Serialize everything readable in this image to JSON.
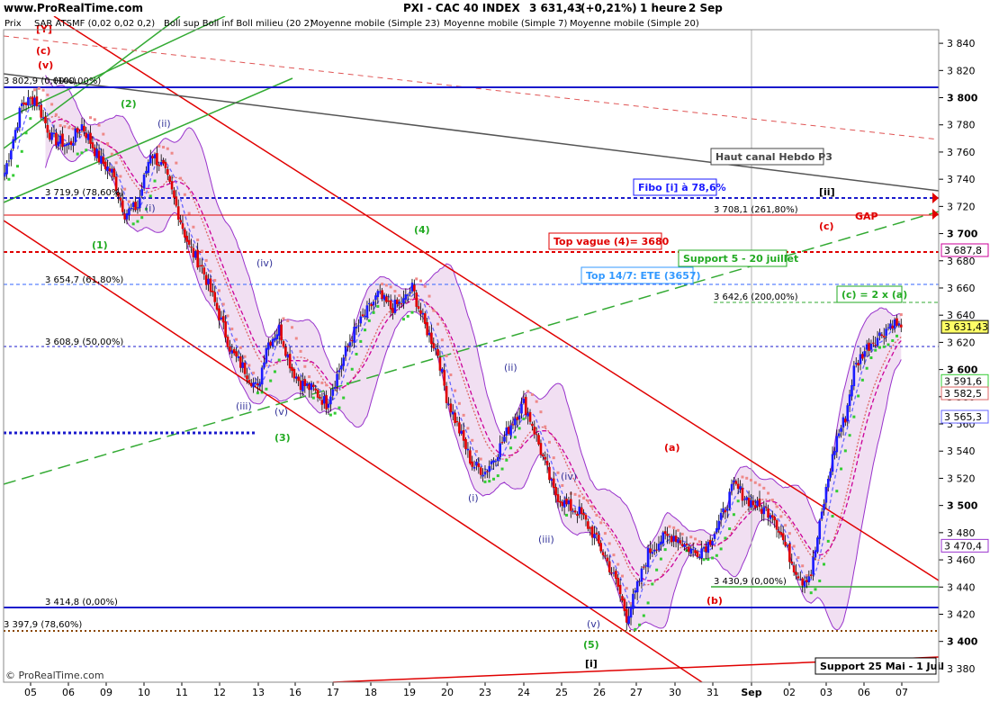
{
  "header": {
    "site": "www.ProRealTime.com",
    "symbol": "PXI - CAC 40 INDEX",
    "price": "3 631,43",
    "change": "(+0,21%)",
    "timeframe": "1 heure",
    "date": "2 Sep"
  },
  "legend": {
    "price_label": "Prix",
    "items": [
      {
        "label": "SAR ATSMF (0,02 0,02 0,2)",
        "color": "#33cc33"
      },
      {
        "label": "Boll sup Boll inf Boll milieu (20 2)",
        "color": "#800080"
      },
      {
        "label": "Moyenne mobile (Simple 23)",
        "color": "#cc0099"
      },
      {
        "label": "Moyenne mobile (Simple 7)",
        "color": "#6666ff"
      },
      {
        "label": "Moyenne mobile (Simple 20)",
        "color": "#dd6666"
      }
    ]
  },
  "copyright": "© ProRealTime.com",
  "colors": {
    "bull": "#1a1aff",
    "bear": "#e00000",
    "boll_fill": "#efd9f0",
    "boll_line": "#9933cc",
    "sar": "#33cc33",
    "sma7": "#6666ff",
    "sma20": "#dd6666",
    "sma23": "#cc0099",
    "channel": "#e00000",
    "green_line": "#33aa33",
    "grey_line": "#555555"
  },
  "chart_data": {
    "type": "candlestick",
    "instrument": "PXI - CAC 40 INDEX",
    "timeframe": "1 heure",
    "ylim": [
      3370,
      3850
    ],
    "y_ticks": [
      3380,
      3400,
      3420,
      3440,
      3460,
      3480,
      3500,
      3520,
      3540,
      3560,
      3580,
      3600,
      3620,
      3640,
      3660,
      3680,
      3700,
      3720,
      3740,
      3760,
      3780,
      3800,
      3820,
      3840
    ],
    "y_tick_labels": [
      "3 380",
      "3 400",
      "3 420",
      "3 440",
      "3 460",
      "3 480",
      "3 500",
      "3 520",
      "3 540",
      "3 560",
      "3 580",
      "3 600",
      "3 620",
      "3 640",
      "3 660",
      "3 680",
      "3 700",
      "3 720",
      "3 740",
      "3 760",
      "3 780",
      "3 800",
      "3 820",
      "3 840"
    ],
    "x_labels": [
      "05",
      "06",
      "09",
      "10",
      "11",
      "12",
      "13",
      "16",
      "17",
      "18",
      "19",
      "20",
      "23",
      "24",
      "25",
      "26",
      "27",
      "30",
      "31",
      "Sep",
      "02",
      "03",
      "06",
      "07"
    ],
    "waypoints": [
      [
        0,
        3745
      ],
      [
        8,
        3795
      ],
      [
        14,
        3800
      ],
      [
        22,
        3770
      ],
      [
        30,
        3765
      ],
      [
        36,
        3780
      ],
      [
        44,
        3755
      ],
      [
        50,
        3745
      ],
      [
        56,
        3715
      ],
      [
        62,
        3720
      ],
      [
        68,
        3760
      ],
      [
        74,
        3748
      ],
      [
        78,
        3730
      ],
      [
        86,
        3690
      ],
      [
        92,
        3675
      ],
      [
        100,
        3640
      ],
      [
        106,
        3612
      ],
      [
        112,
        3600
      ],
      [
        118,
        3585
      ],
      [
        122,
        3618
      ],
      [
        128,
        3630
      ],
      [
        134,
        3600
      ],
      [
        138,
        3590
      ],
      [
        144,
        3585
      ],
      [
        150,
        3575
      ],
      [
        156,
        3600
      ],
      [
        162,
        3625
      ],
      [
        168,
        3640
      ],
      [
        174,
        3655
      ],
      [
        180,
        3645
      ],
      [
        186,
        3650
      ],
      [
        190,
        3660
      ],
      [
        196,
        3632
      ],
      [
        202,
        3612
      ],
      [
        206,
        3580
      ],
      [
        212,
        3555
      ],
      [
        218,
        3530
      ],
      [
        224,
        3525
      ],
      [
        230,
        3540
      ],
      [
        236,
        3560
      ],
      [
        242,
        3575
      ],
      [
        246,
        3560
      ],
      [
        250,
        3540
      ],
      [
        256,
        3510
      ],
      [
        262,
        3500
      ],
      [
        268,
        3495
      ],
      [
        274,
        3480
      ],
      [
        280,
        3462
      ],
      [
        286,
        3440
      ],
      [
        290,
        3418
      ],
      [
        294,
        3435
      ],
      [
        300,
        3465
      ],
      [
        306,
        3475
      ],
      [
        312,
        3478
      ],
      [
        318,
        3470
      ],
      [
        322,
        3465
      ],
      [
        328,
        3472
      ],
      [
        334,
        3490
      ],
      [
        340,
        3515
      ],
      [
        346,
        3505
      ],
      [
        352,
        3498
      ],
      [
        358,
        3495
      ],
      [
        364,
        3470
      ],
      [
        368,
        3455
      ],
      [
        372,
        3445
      ],
      [
        376,
        3450
      ],
      [
        380,
        3485
      ],
      [
        384,
        3520
      ],
      [
        388,
        3550
      ],
      [
        392,
        3565
      ],
      [
        396,
        3600
      ],
      [
        400,
        3612
      ],
      [
        404,
        3620
      ],
      [
        408,
        3625
      ],
      [
        414,
        3635
      ],
      [
        418,
        3631
      ]
    ],
    "annotation_levels": [
      {
        "label": "3 802,9 (0,00%)",
        "value": 3802.9
      },
      {
        "label": "(100,00%)",
        "value": 3802.9
      },
      {
        "label": "3 719,9 (78,60%)",
        "value": 3719.9
      },
      {
        "label": "3 708,1 (261,80%)",
        "value": 3708.1
      },
      {
        "label": "3 654,7 (61,80%)",
        "value": 3654.7
      },
      {
        "label": "3 642,6 (200,00%)",
        "value": 3642.6
      },
      {
        "label": "3 608,9 (50,00%)",
        "value": 3608.9
      },
      {
        "label": "3 430,9 (0,00%)",
        "value": 3430.9
      },
      {
        "label": "3 414,8 (0,00%)",
        "value": 3414.8
      },
      {
        "label": "3 397,9 (78,60%)",
        "value": 3397.9
      }
    ],
    "price_badges": [
      {
        "label": "3 687,8",
        "value": 3687.8,
        "color": "#cc0099"
      },
      {
        "label": "3 631,43",
        "value": 3631.43,
        "color": "#000000",
        "fill": "#ffff66"
      },
      {
        "label": "3 591,6",
        "value": 3591.6,
        "color": "#33cc33"
      },
      {
        "label": "3 582,5",
        "value": 3582.5,
        "color": "#dd6666"
      },
      {
        "label": "3 565,3",
        "value": 3565.3,
        "color": "#6666ff"
      },
      {
        "label": "3 470,4",
        "value": 3470.4,
        "color": "#9933cc"
      }
    ],
    "boxes": [
      {
        "label": "Haut canal Hebdo P3",
        "color": "#444444"
      },
      {
        "label": "Fibo [i] à 78,6%",
        "color": "#1a1aff"
      },
      {
        "label": "GAP",
        "color": "#e00000"
      },
      {
        "label": "Top vague (4)= 3680",
        "color": "#e00000"
      },
      {
        "label": "Support 5 - 20 juillet",
        "color": "#22aa22"
      },
      {
        "label": "Top 14/7: ETE (3657)",
        "color": "#3399ff"
      },
      {
        "label": "(c) = 2 x (a)",
        "color": "#22aa22"
      },
      {
        "label": "Support 25 Mai - 1 Juil",
        "color": "#000000"
      }
    ],
    "wave_labels": [
      {
        "label": "[Y]",
        "color": "#e00000"
      },
      {
        "label": "(c)",
        "color": "#e00000"
      },
      {
        "label": "(v)",
        "color": "#e00000"
      },
      {
        "label": "(2)",
        "color": "#22aa22"
      },
      {
        "label": "(ii)",
        "color": "#333399"
      },
      {
        "label": "(i)",
        "color": "#333399"
      },
      {
        "label": "(1)",
        "color": "#22aa22"
      },
      {
        "label": "(iv)",
        "color": "#333399"
      },
      {
        "label": "(iii)",
        "color": "#333399"
      },
      {
        "label": "(v)",
        "color": "#333399"
      },
      {
        "label": "(3)",
        "color": "#22aa22"
      },
      {
        "label": "(4)",
        "color": "#22aa22"
      },
      {
        "label": "(ii)",
        "color": "#333399"
      },
      {
        "label": "(iv)",
        "color": "#333399"
      },
      {
        "label": "(i)",
        "color": "#333399"
      },
      {
        "label": "(iii)",
        "color": "#333399"
      },
      {
        "label": "(v)",
        "color": "#333399"
      },
      {
        "label": "(5)",
        "color": "#22aa22"
      },
      {
        "label": "[i]",
        "color": "#000000"
      },
      {
        "label": "(a)",
        "color": "#e00000"
      },
      {
        "label": "(b)",
        "color": "#e00000"
      },
      {
        "label": "(c)",
        "color": "#e00000"
      },
      {
        "label": "[ii]",
        "color": "#000000"
      }
    ]
  }
}
